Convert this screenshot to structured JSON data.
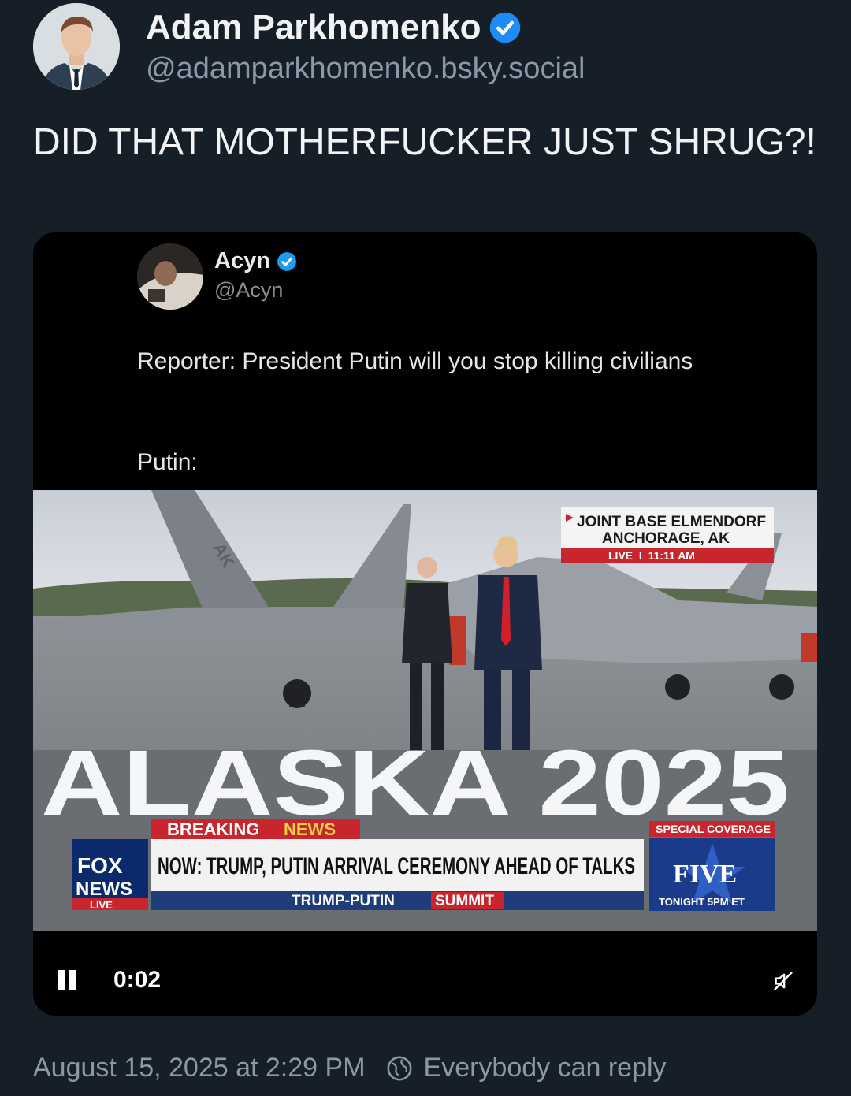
{
  "author": {
    "name": "Adam Parkhomenko",
    "handle": "@adamparkhomenko.bsky.social",
    "verified": true
  },
  "post": {
    "text": "DID THAT MOTHERFUCKER JUST SHRUG?!"
  },
  "quoted_post": {
    "name": "Acyn",
    "handle": "@Acyn",
    "verified": true,
    "text": "Reporter: President Putin will you stop killing civilians",
    "text_putin": "Putin:"
  },
  "video": {
    "location_line1": "JOINT BASE ELMENDORF",
    "location_line2": "ANCHORAGE, AK",
    "live_time": "LIVE  I  11:11 AM",
    "backdrop_text": "ALASKA 2025",
    "breaking_label": "BREAKING",
    "news_label": "NEWS",
    "headline": "NOW: TRUMP, PUTIN ARRIVAL CEREMONY AHEAD OF TALKS",
    "summit_left": "TRUMP-PUTIN",
    "summit_right": "SUMMIT",
    "network_line1": "FOX",
    "network_line2": "NEWS",
    "network_live": "LIVE",
    "special_coverage": "SPECIAL COVERAGE",
    "show_name": "FIVE",
    "show_time": "TONIGHT 5PM ET",
    "tail_marking": "AK",
    "timestamp": "0:02"
  },
  "footer": {
    "date": "August 15, 2025 at 2:29 PM",
    "reply_setting": "Everybody can reply"
  },
  "colors": {
    "background": "#161e27",
    "accent_blue": "#1d8cf8",
    "fox_red": "#c8262c"
  },
  "icons": [
    "verified-badge-icon",
    "pause-icon",
    "mute-icon",
    "globe-icon"
  ]
}
